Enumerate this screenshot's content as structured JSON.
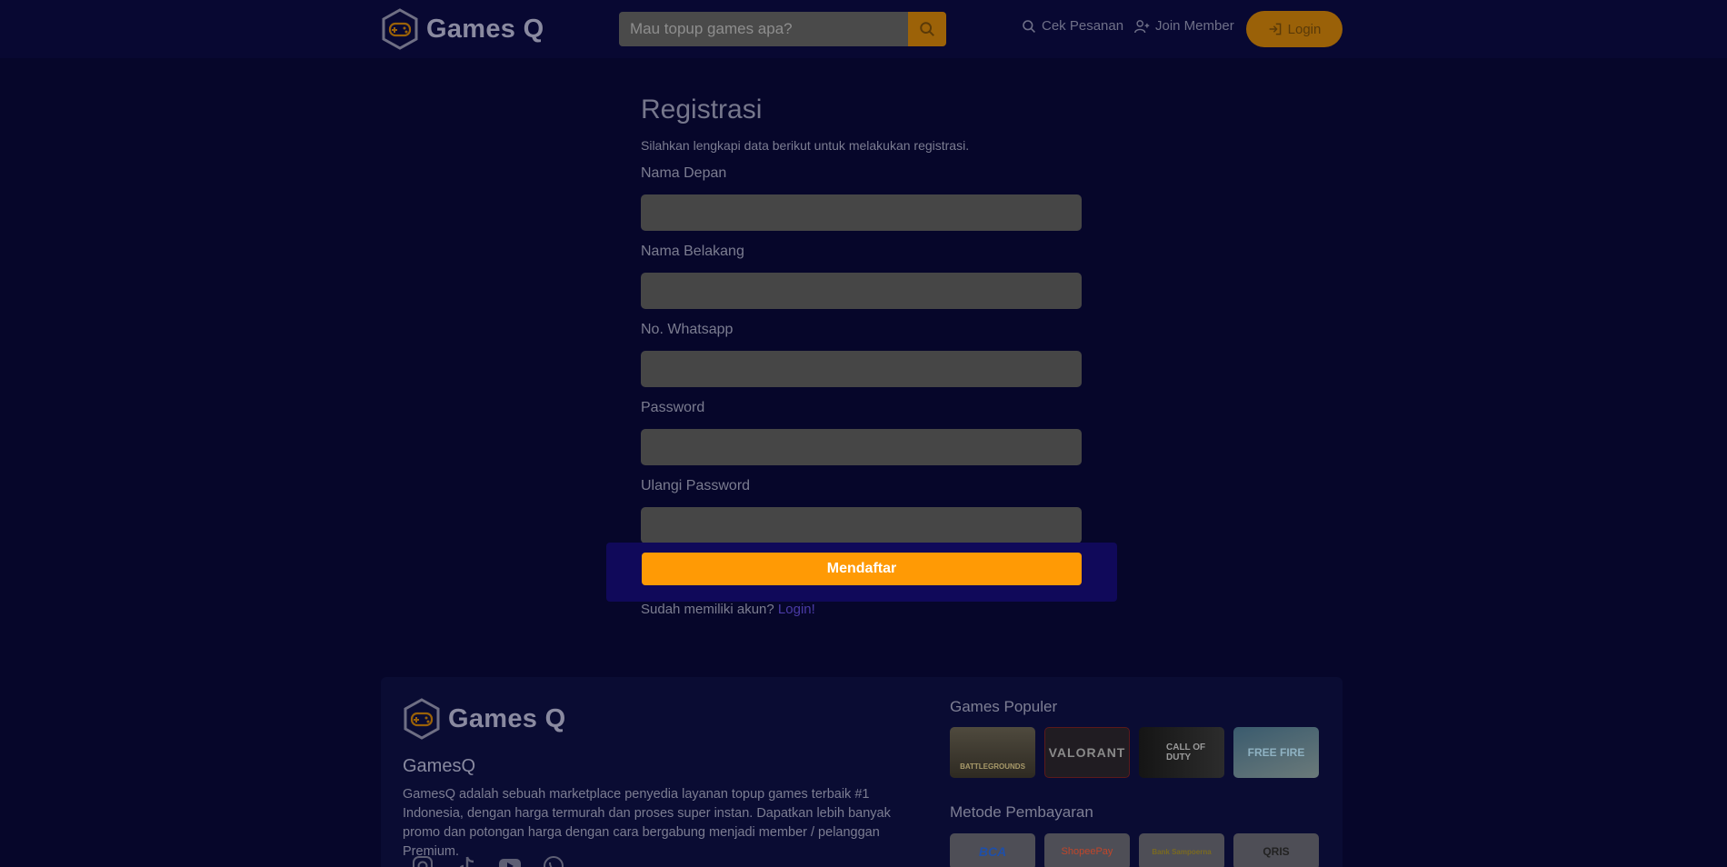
{
  "header": {
    "brand": "Games Q",
    "search_placeholder": "Mau topup games apa?",
    "nav": {
      "cek_pesanan": "Cek Pesanan",
      "join_member": "Join Member",
      "login": "Login"
    }
  },
  "form": {
    "title": "Registrasi",
    "subtitle": "Silahkan lengkapi data berikut untuk melakukan registrasi.",
    "fields": {
      "first_name": {
        "label": "Nama Depan",
        "value": ""
      },
      "last_name": {
        "label": "Nama Belakang",
        "value": ""
      },
      "whatsapp": {
        "label": "No. Whatsapp",
        "value": ""
      },
      "password": {
        "label": "Password",
        "value": ""
      },
      "confirm_password": {
        "label": "Ulangi Password",
        "value": ""
      }
    },
    "submit_label": "Mendaftar",
    "have_account_text": "Sudah memiliki akun?",
    "login_link": "Login!"
  },
  "footer": {
    "brand": "Games Q",
    "company_name": "GamesQ",
    "description": "GamesQ adalah sebuah marketplace penyedia layanan topup games terbaik #1 Indonesia, dengan harga termurah dan proses super instan. Dapatkan lebih banyak promo dan potongan harga dengan cara bergabung menjadi member / pelanggan Premium.",
    "socials": [
      "instagram-icon",
      "tiktok-icon",
      "youtube-icon",
      "whatsapp-icon"
    ],
    "popular_games_heading": "Games Populer",
    "popular_games": [
      {
        "label": "BATTLEGROUNDS"
      },
      {
        "label": "VALORANT"
      },
      {
        "label": "CALL OF DUTY"
      },
      {
        "label": "FREE FIRE"
      }
    ],
    "payment_heading": "Metode Pembayaran",
    "payments": [
      {
        "label": "BCA",
        "color": "#1f4fa8"
      },
      {
        "label": "ShopeePay",
        "color": "#c0462a"
      },
      {
        "label": "Bank Sampoerna",
        "color": "#7a6a20"
      },
      {
        "label": "QRIS",
        "color": "#222222"
      }
    ]
  },
  "colors": {
    "background": "#06062a",
    "accent": "#ff9a05",
    "accent_dim": "#9a6108",
    "submit_panel": "#10095a"
  }
}
